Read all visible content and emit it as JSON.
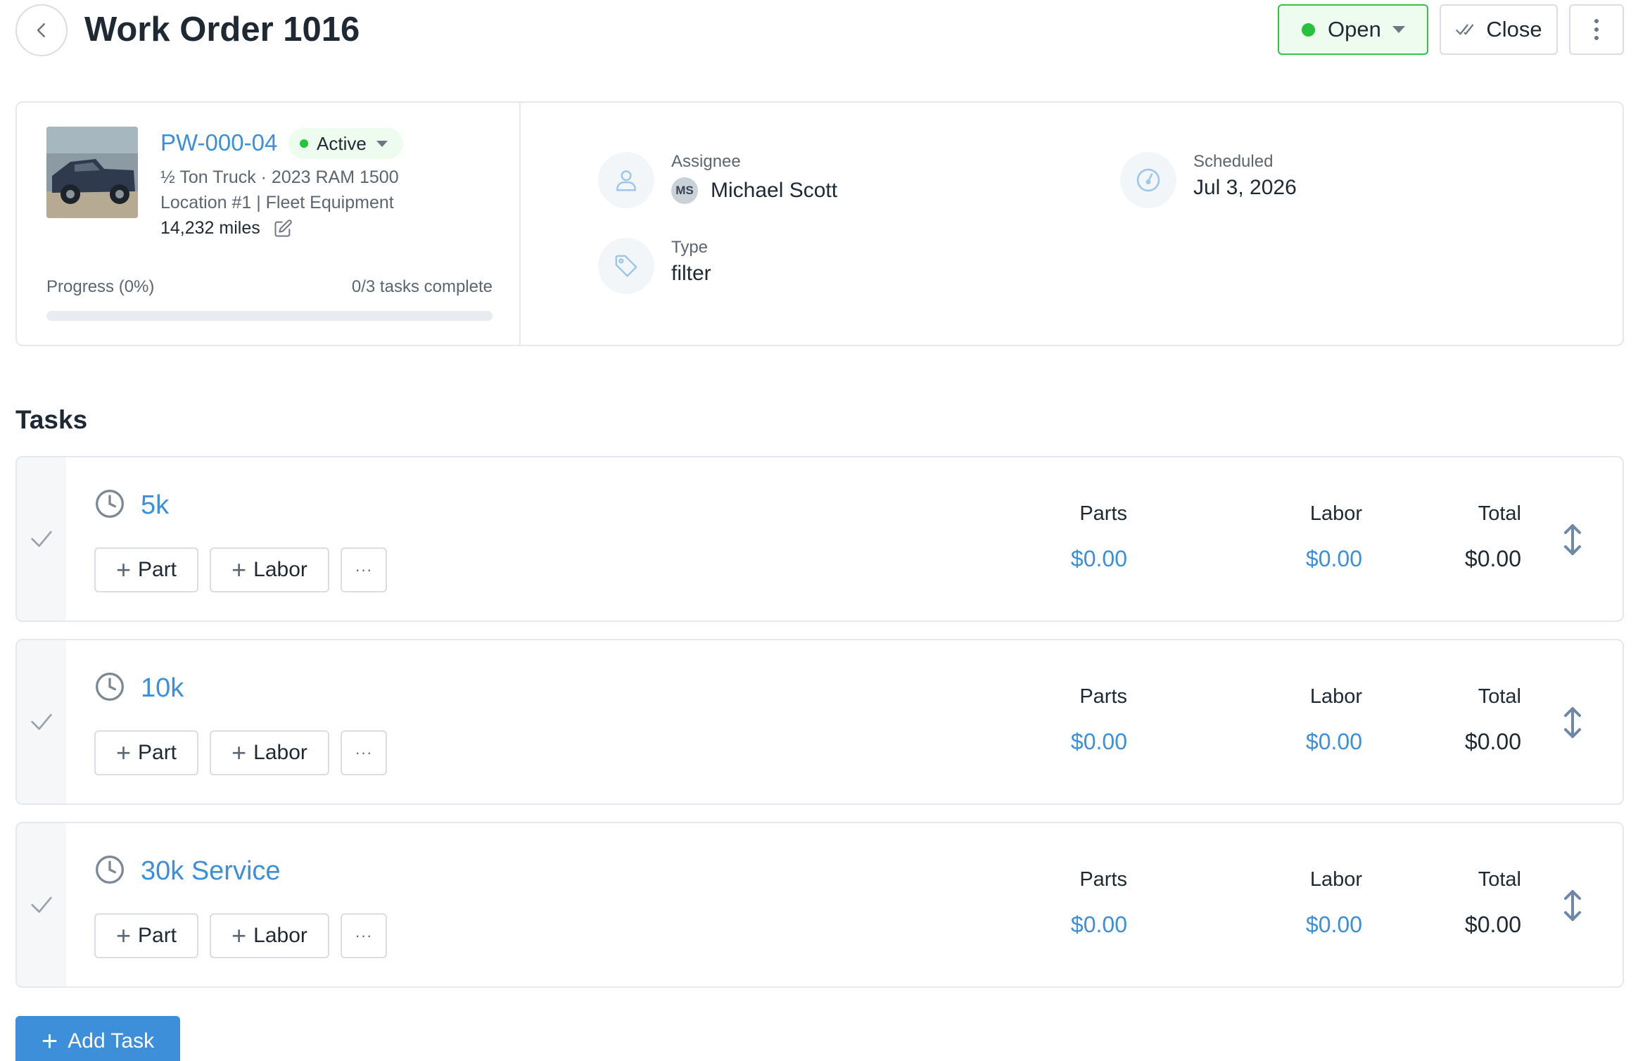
{
  "header": {
    "title": "Work Order 1016",
    "status_label": "Open",
    "close_label": "Close"
  },
  "vehicle": {
    "id": "PW-000-04",
    "status": "Active",
    "description": "½ Ton Truck · 2023 RAM 1500",
    "location": "Location #1 | Fleet Equipment",
    "mileage": "14,232 miles"
  },
  "progress": {
    "label": "Progress (0%)",
    "count": "0/3 tasks complete",
    "percent": 0
  },
  "details": {
    "assignee_label": "Assignee",
    "assignee_initials": "MS",
    "assignee_name": "Michael Scott",
    "scheduled_label": "Scheduled",
    "scheduled_value": "Jul 3, 2026",
    "type_label": "Type",
    "type_value": "filter"
  },
  "tasks_section": {
    "title": "Tasks",
    "part_label": "Part",
    "labor_label": "Labor",
    "more_label": "···",
    "parts_header": "Parts",
    "labor_header": "Labor",
    "total_header": "Total",
    "add_task_label": "Add Task"
  },
  "tasks": [
    {
      "name": "5k",
      "parts": "$0.00",
      "labor": "$0.00",
      "total": "$0.00"
    },
    {
      "name": "10k",
      "parts": "$0.00",
      "labor": "$0.00",
      "total": "$0.00"
    },
    {
      "name": "30k Service",
      "parts": "$0.00",
      "labor": "$0.00",
      "total": "$0.00"
    }
  ],
  "colors": {
    "accent": "#3d8fd9",
    "status_green": "#28c23c",
    "border": "#e5e9ee"
  }
}
